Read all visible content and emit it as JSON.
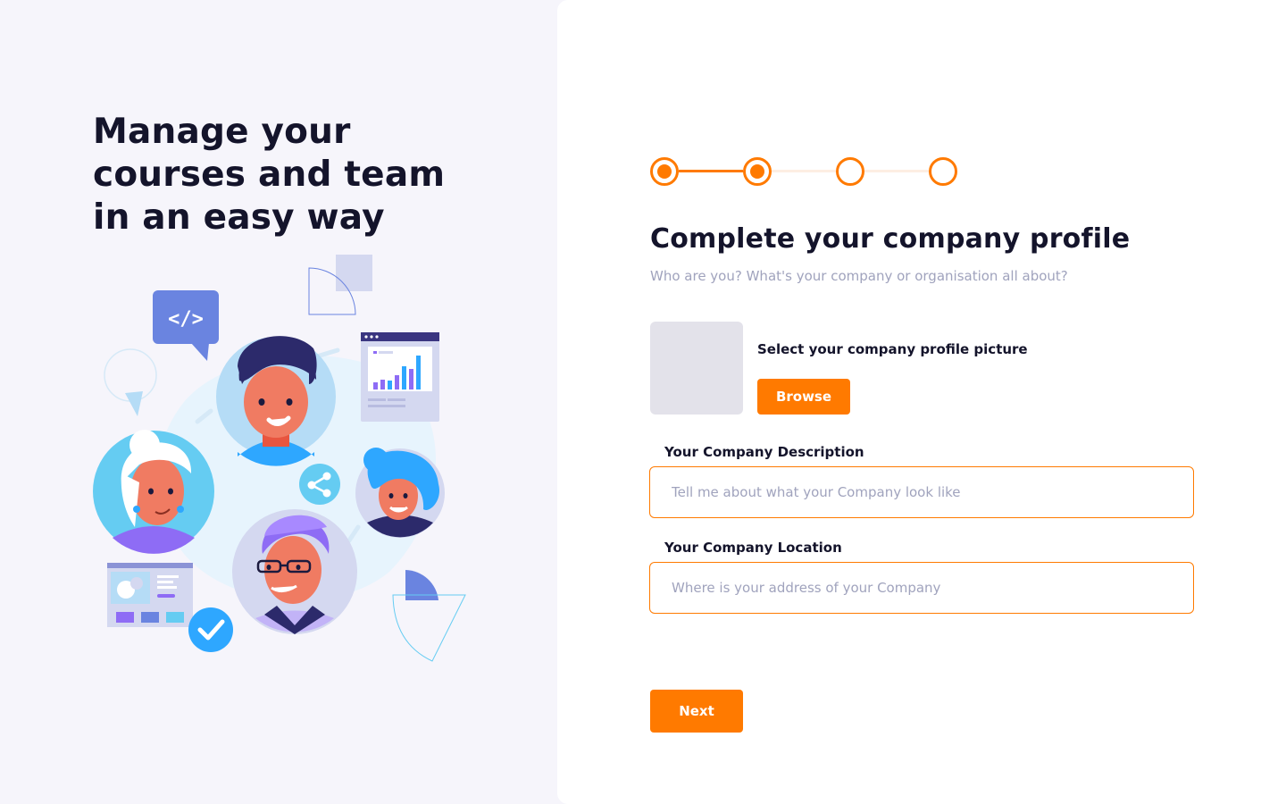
{
  "hero": {
    "title": "Manage your courses and team in an easy way"
  },
  "illustration": {
    "code_tag": "</>",
    "icons": [
      "code-bubble-icon",
      "share-icon",
      "checkmark-icon",
      "bar-chart-card-icon",
      "dashboard-card-icon"
    ]
  },
  "stepper": {
    "total_steps": 4,
    "current_step": 2
  },
  "form": {
    "title": "Complete your company profile",
    "subtitle": "Who are you? What's your company or organisation all about?",
    "picture_label": "Select your company profile picture",
    "browse_label": "Browse",
    "description": {
      "label": "Your Company Description",
      "value": "",
      "placeholder": "Tell me about what your Company look like"
    },
    "location": {
      "label": "Your Company Location",
      "value": "",
      "placeholder": "Where is your address of your Company"
    },
    "next_label": "Next"
  },
  "colors": {
    "accent": "#ff7a00",
    "heading": "#14142b",
    "muted": "#a0a3bd",
    "left_bg": "#f6f5fb",
    "right_bg": "#ffffff",
    "placeholder_box": "#e3e2ea"
  }
}
